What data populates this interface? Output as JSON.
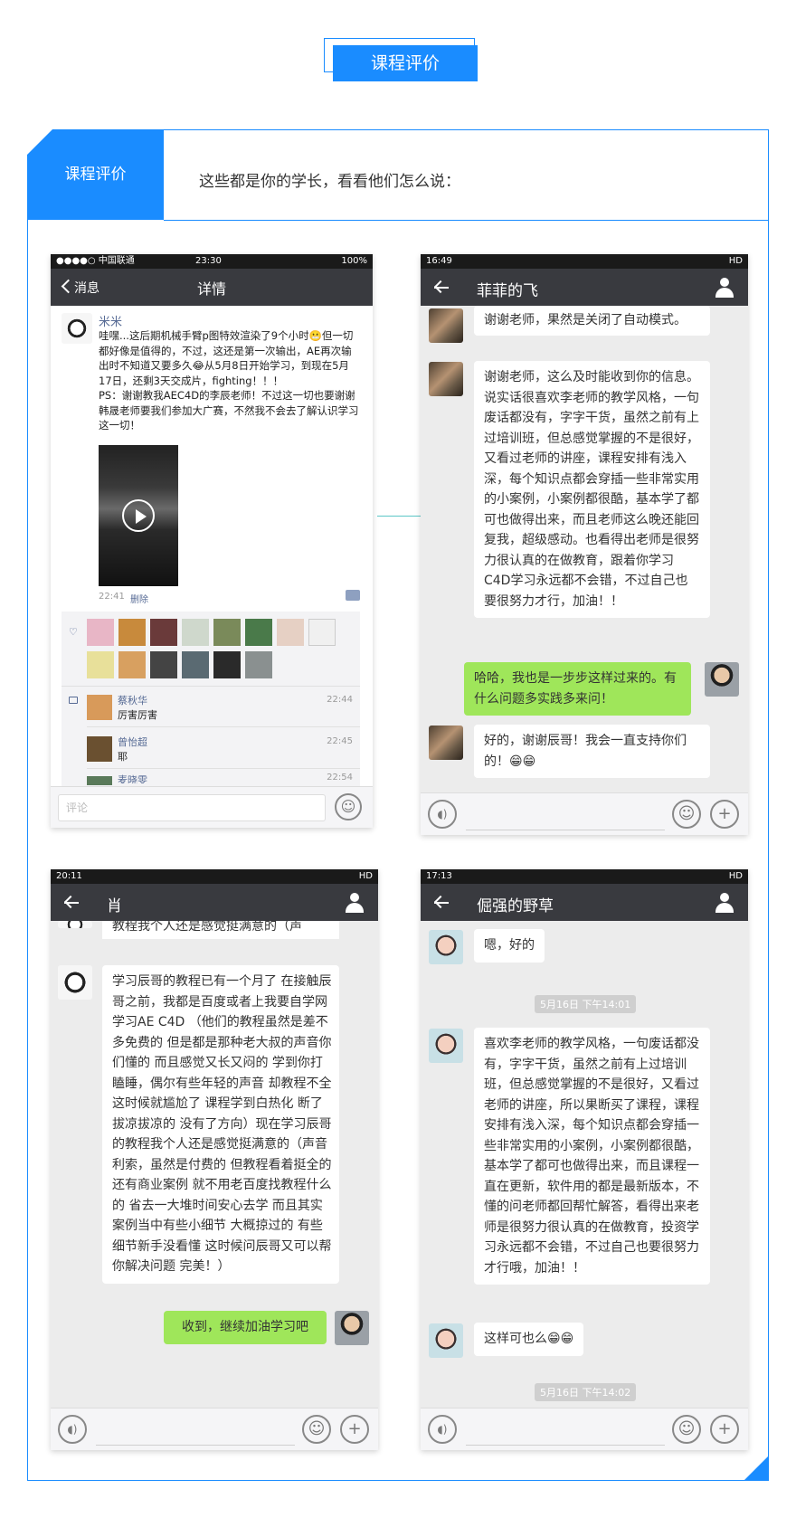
{
  "header": {
    "badge": "课程评价"
  },
  "section": {
    "tab_label": "课程评价",
    "intro": "这些都是你的学长，看看他们怎么说："
  },
  "phone1": {
    "status": {
      "carrier": "●●●●○ 中国联通 ",
      "time": "23:30",
      "battery": "100%"
    },
    "nav": {
      "back": "消息",
      "title": "详情"
    },
    "post": {
      "name": "米米",
      "text": "哇嘿...这后期机械手臂p图特效渲染了9个小时😬但一切都好像是值得的，不过，这还是第一次输出，AE再次输出时不知道又要多久😂从5月8日开始学习，到现在5月17日，还剩3天交成片，fighting！！！\nPS：谢谢教我AEC4D的李辰老师！不过这一切也要谢谢韩晟老师要我们参加大广赛，不然我不会去了解认识学习这一切！",
      "time": "22:41",
      "delete": "删除"
    },
    "comments": [
      {
        "name": "蔡秋华",
        "text": "厉害厉害",
        "time": "22:44"
      },
      {
        "name": "曾怡超",
        "text": "耶",
        "time": "22:45"
      },
      {
        "name": "麦晓雯",
        "text": "",
        "time": "22:54"
      }
    ],
    "input_placeholder": "评论"
  },
  "phone2": {
    "status": {
      "time": "16:49",
      "right": "HD"
    },
    "title": "菲菲的飞",
    "messages": [
      {
        "from": "other",
        "text": "谢谢老师，果然是关闭了自动模式。"
      },
      {
        "from": "other",
        "text": "谢谢老师，这么及时能收到你的信息。说实话很喜欢李老师的教学风格，一句废话都没有，字字干货，虽然之前有上过培训班，但总感觉掌握的不是很好，又看过老师的讲座，课程安排有浅入深，每个知识点都会穿插一些非常实用的小案例，小案例都很酷，基本学了都可也做得出来，而且老师这么晚还能回复我，超级感动。也看得出老师是很努力很认真的在做教育，跟着你学习C4D学习永远都不会错，不过自己也要很努力才行，加油！！"
      },
      {
        "from": "me",
        "text": "哈哈，我也是一步步这样过来的。有什么问题多实践多来问！"
      },
      {
        "from": "other",
        "text": "好的，谢谢辰哥！我会一直支持你们的！😁😁"
      }
    ]
  },
  "phone3": {
    "status": {
      "time": "20:11",
      "right": "HD"
    },
    "title": "肖",
    "messages": [
      {
        "from": "other",
        "text": "教程我个人还是感觉挺满意的（声"
      },
      {
        "from": "other",
        "text": "学习辰哥的教程已有一个月了 在接触辰哥之前，我都是百度或者上我要自学网学习AE C4D （他们的教程虽然是差不多免费的 但是都是那种老大叔的声音你们懂的 而且感觉又长又闷的 学到你打瞌睡，偶尔有些年轻的声音 却教程不全 这时候就尴尬了 课程学到白热化 断了拔凉拔凉的 没有了方向）现在学习辰哥的教程我个人还是感觉挺满意的（声音利索，虽然是付费的 但教程看着挺全的 还有商业案例 就不用老百度找教程什么的 省去一大堆时间安心去学 而且其实案例当中有些小细节 大概掠过的 有些细节新手没看懂 这时候问辰哥又可以帮你解决问题 完美！）"
      },
      {
        "from": "me",
        "text": "收到，继续加油学习吧"
      }
    ]
  },
  "phone4": {
    "status": {
      "time": "17:13",
      "right": "HD"
    },
    "title": "倔强的野草",
    "messages": [
      {
        "from": "other",
        "text": "嗯，好的"
      },
      {
        "from": "time",
        "text": "5月16日 下午14:01"
      },
      {
        "from": "other",
        "text": "喜欢李老师的教学风格，一句废话都没有，字字干货，虽然之前有上过培训班，但总感觉掌握的不是很好，又看过老师的讲座，所以果断买了课程，课程安排有浅入深，每个知识点都会穿插一些非常实用的小案例，小案例都很酷，基本学了都可也做得出来，而且课程一直在更新，软件用的都是最新版本，不懂的问老师都回帮忙解答，看得出来老师是很努力很认真的在做教育，投资学习永远都不会错，不过自己也要很努力才行哦，加油！！"
      },
      {
        "from": "other",
        "text": "这样可也么😁😁"
      },
      {
        "from": "time",
        "text": "5月16日 下午14:02"
      }
    ]
  },
  "colors": {
    "accent": "#1a8cff",
    "navbar": "#393a3f",
    "chat_bg": "#ececec",
    "my_bubble": "#9fe65a"
  }
}
